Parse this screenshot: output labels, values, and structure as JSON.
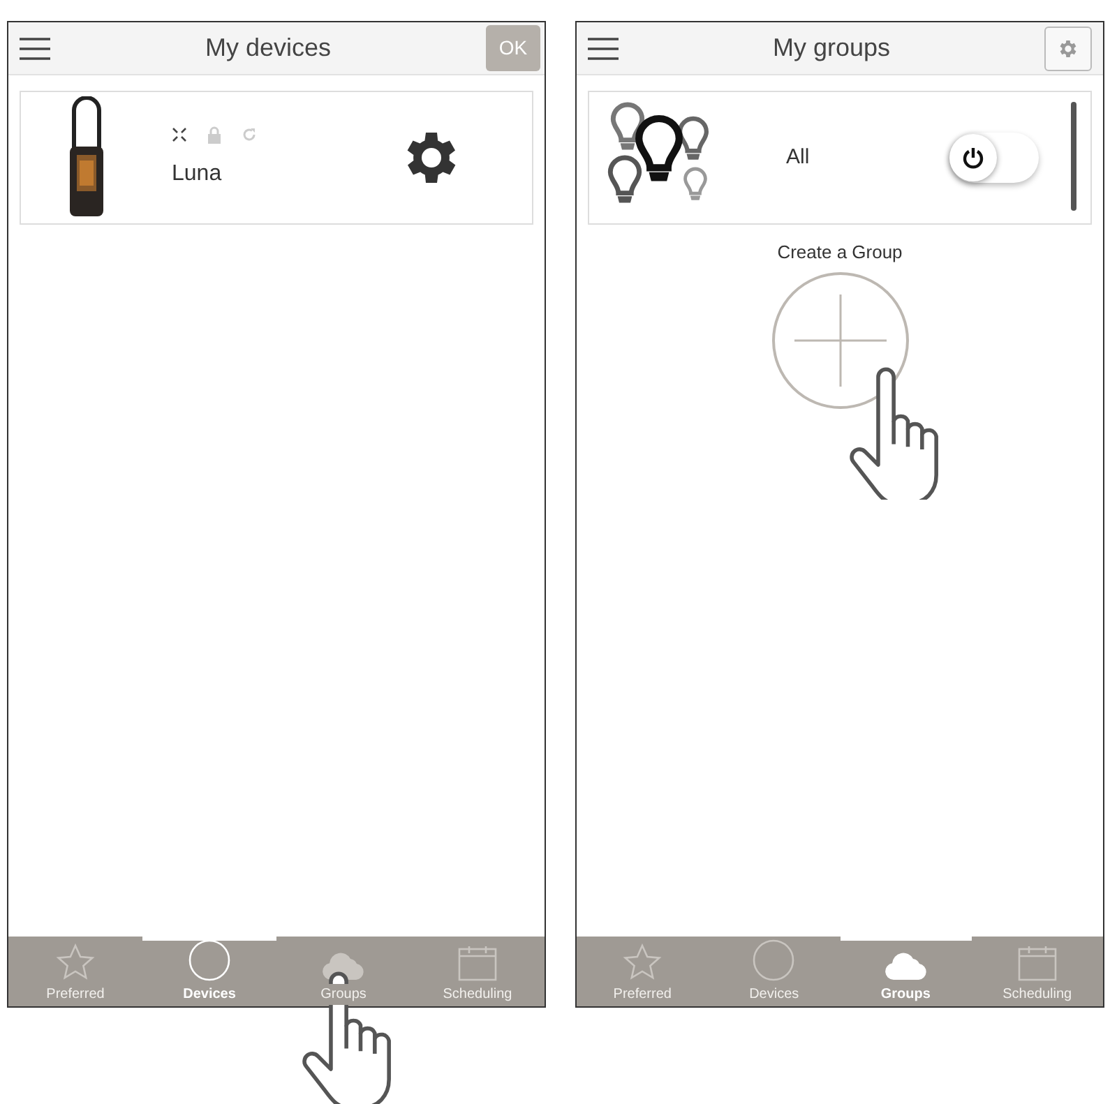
{
  "screens": [
    {
      "title": "My devices",
      "header_button": {
        "kind": "text",
        "label": "OK"
      },
      "devices": [
        {
          "name": "Luna"
        }
      ],
      "tabs": [
        {
          "kind": "star",
          "label": "Preferred",
          "selected": false
        },
        {
          "kind": "circle",
          "label": "Devices",
          "selected": true
        },
        {
          "kind": "cloud",
          "label": "Groups",
          "selected": false
        },
        {
          "kind": "calendar",
          "label": "Scheduling",
          "selected": false
        }
      ]
    },
    {
      "title": "My groups",
      "header_button": {
        "kind": "icon"
      },
      "groups": [
        {
          "name": "All",
          "on": false
        }
      ],
      "create_label": "Create a Group",
      "tabs": [
        {
          "kind": "star",
          "label": "Preferred",
          "selected": false
        },
        {
          "kind": "circle",
          "label": "Devices",
          "selected": false
        },
        {
          "kind": "cloud",
          "label": "Groups",
          "selected": true
        },
        {
          "kind": "calendar",
          "label": "Scheduling",
          "selected": false
        }
      ]
    }
  ]
}
